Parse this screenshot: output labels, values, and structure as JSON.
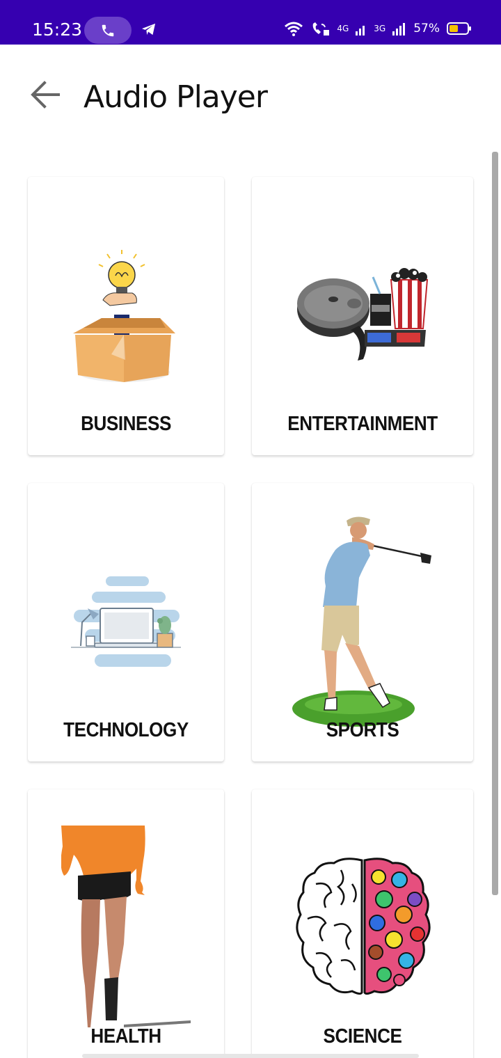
{
  "status_bar": {
    "time": "15:23",
    "network_a": "4G",
    "network_b": "3G",
    "battery_pct": "57%",
    "battery_level": 0.57
  },
  "app_bar": {
    "title": "Audio Player"
  },
  "categories": [
    {
      "label": "BUSINESS",
      "icon": "business-lightbulb-box-icon"
    },
    {
      "label": "ENTERTAINMENT",
      "icon": "entertainment-film-popcorn-icon"
    },
    {
      "label": "TECHNOLOGY",
      "icon": "technology-laptop-desk-icon"
    },
    {
      "label": "SPORTS",
      "icon": "sports-golfer-icon"
    },
    {
      "label": "HEALTH",
      "icon": "health-runner-icon"
    },
    {
      "label": "SCIENCE",
      "icon": "science-brain-icon"
    }
  ],
  "colors": {
    "status_bar": "#3600b0",
    "card_bg": "#ffffff",
    "label": "#111111"
  }
}
